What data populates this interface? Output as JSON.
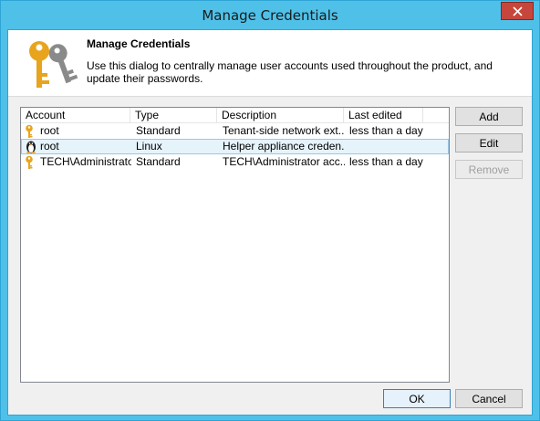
{
  "window": {
    "title": "Manage Credentials",
    "close_label": "✕"
  },
  "header": {
    "title": "Manage Credentials",
    "description": "Use this dialog to centrally manage user accounts used throughout the product, and update their passwords.",
    "icon": "keys-icon"
  },
  "list": {
    "columns": [
      "Account",
      "Type",
      "Description",
      "Last edited"
    ],
    "rows": [
      {
        "icon": "key-icon",
        "account": "root",
        "type": "Standard",
        "description": "Tenant-side network ext...",
        "last_edited": "less than a day ...",
        "selected": false
      },
      {
        "icon": "linux-penguin-icon",
        "account": "root",
        "type": "Linux",
        "description": "Helper appliance creden...",
        "last_edited": "",
        "selected": true
      },
      {
        "icon": "key-icon",
        "account": "TECH\\Administrator",
        "type": "Standard",
        "description": "TECH\\Administrator acc...",
        "last_edited": "less than a day ...",
        "selected": false
      }
    ]
  },
  "buttons": {
    "add": "Add",
    "edit": "Edit",
    "remove": "Remove",
    "ok": "OK",
    "cancel": "Cancel"
  },
  "colors": {
    "title_bar": "#4fc1e9",
    "close_button": "#c7463c",
    "selection": "#e5f3fb",
    "key_gold": "#e8a41c",
    "key_gray": "#8a8a8a"
  }
}
